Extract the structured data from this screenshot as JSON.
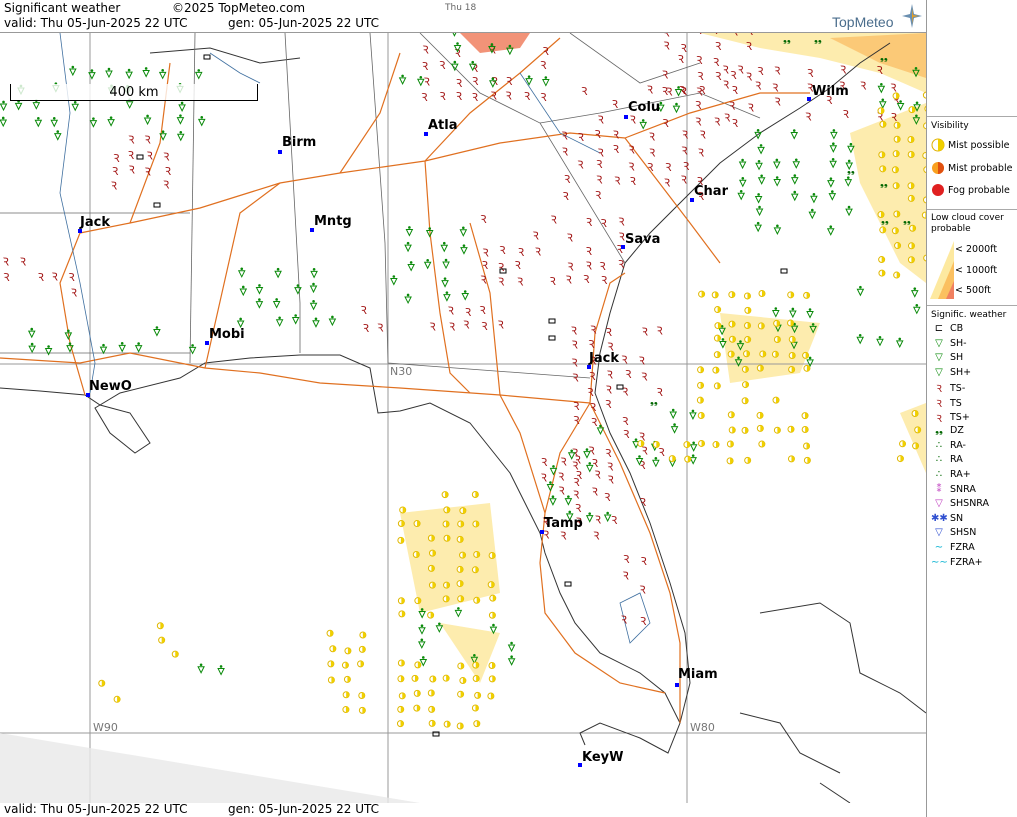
{
  "header": {
    "title": "Significant weather",
    "copyright": "©2025 TopMeteo.com",
    "day_tab": "Thu 18",
    "valid_label": "valid:  Thu  05-Jun-2025  22 UTC",
    "gen_label": "gen: 05-Jun-2025 22 UTC",
    "logo": "TopMeteo"
  },
  "footer": {
    "valid_label": "valid:  Thu  05-Jun-2025  22 UTC",
    "gen_label": "gen: 05-Jun-2025 22 UTC"
  },
  "map": {
    "scale_label": "400 km",
    "grid_labels": {
      "lat": "N30",
      "lon_w90": "W90",
      "lon_w80": "W80"
    },
    "cities": [
      "Wilm",
      "Colu",
      "Atla",
      "Birm",
      "Char",
      "Jack",
      "Mntg",
      "Sava",
      "Mobi",
      "Jack",
      "NewO",
      "Tamp",
      "Miam",
      "KeyW"
    ],
    "symbols": {
      "ts": "thunderstorm-icon",
      "sh": "shower-icon",
      "mist": "mist-possible-icon",
      "cb": "cb-icon",
      "dz": "drizzle-icon"
    }
  },
  "legend": {
    "visibility": {
      "title": "Visibility",
      "items": [
        "Mist possible",
        "Mist probable",
        "Fog probable"
      ]
    },
    "low_cloud": {
      "title": "Low cloud cover probable",
      "items": [
        "< 2000ft",
        "< 1000ft",
        "<   500ft"
      ]
    },
    "sigwx": {
      "title": "Signific. weather",
      "items": [
        "CB",
        "SH-",
        "SH",
        "SH+",
        "TS-",
        "TS",
        "TS+",
        "DZ",
        "RA-",
        "RA",
        "RA+",
        "SNRA",
        "SHSNRA",
        "SN",
        "SHSN",
        "FZRA",
        "FZRA+"
      ]
    }
  },
  "colors": {
    "road": "#e07020",
    "ts": "#a01010",
    "sh": "#0a8a0a",
    "mist": "#f0d000",
    "fog": "#e03030",
    "lowcloud_light": "#fde9a0",
    "lowcloud_mid": "#fbc060",
    "lowcloud_dark": "#f08060"
  }
}
